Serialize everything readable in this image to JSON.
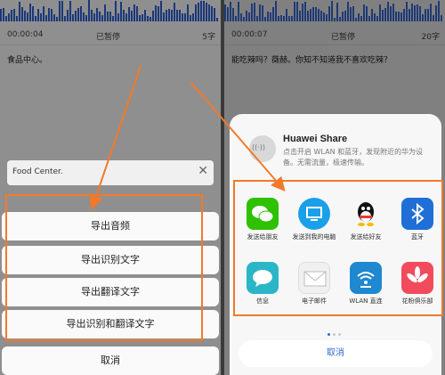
{
  "left": {
    "status": {
      "time": "00:00:04",
      "state": "已暂停",
      "count": "5字"
    },
    "transcript": "食品中心。",
    "food_center": "Food Center.",
    "menu": [
      "导出音频",
      "导出识别文字",
      "导出翻译文字",
      "导出识别和翻译文字"
    ],
    "cancel": "取消"
  },
  "right": {
    "status": {
      "time": "00:00:07",
      "state": "已暂停",
      "count": "20字"
    },
    "transcript": "能吃辣吗？薇赫。你知不知道我不喜欢吃辣？",
    "share": {
      "title": "Huawei Share",
      "desc": "点击开启 WLAN 和蓝牙，发现附近的华为设备。无需流量，极速传输。",
      "apps": [
        {
          "label": "发送给朋友",
          "icon": "wechat-icon",
          "color": "#2dc100"
        },
        {
          "label": "发送到我的电脑",
          "icon": "computer-icon",
          "color": "#1aa0e8"
        },
        {
          "label": "发送给好友",
          "icon": "qq-icon",
          "color": "#ffffff"
        },
        {
          "label": "蓝牙",
          "icon": "bluetooth-icon",
          "color": "#1f6fd6"
        },
        {
          "label": "信息",
          "icon": "message-icon",
          "color": "#2ab6c6"
        },
        {
          "label": "电子邮件",
          "icon": "mail-icon",
          "color": "#f0f0f0"
        },
        {
          "label": "WLAN 直连",
          "icon": "wifi-direct-icon",
          "color": "#1e88d0"
        },
        {
          "label": "花粉俱乐部",
          "icon": "huawei-club-icon",
          "color": "#f24b5c"
        }
      ],
      "cancel": "取消"
    }
  },
  "annotation_color": "#f07a2a"
}
